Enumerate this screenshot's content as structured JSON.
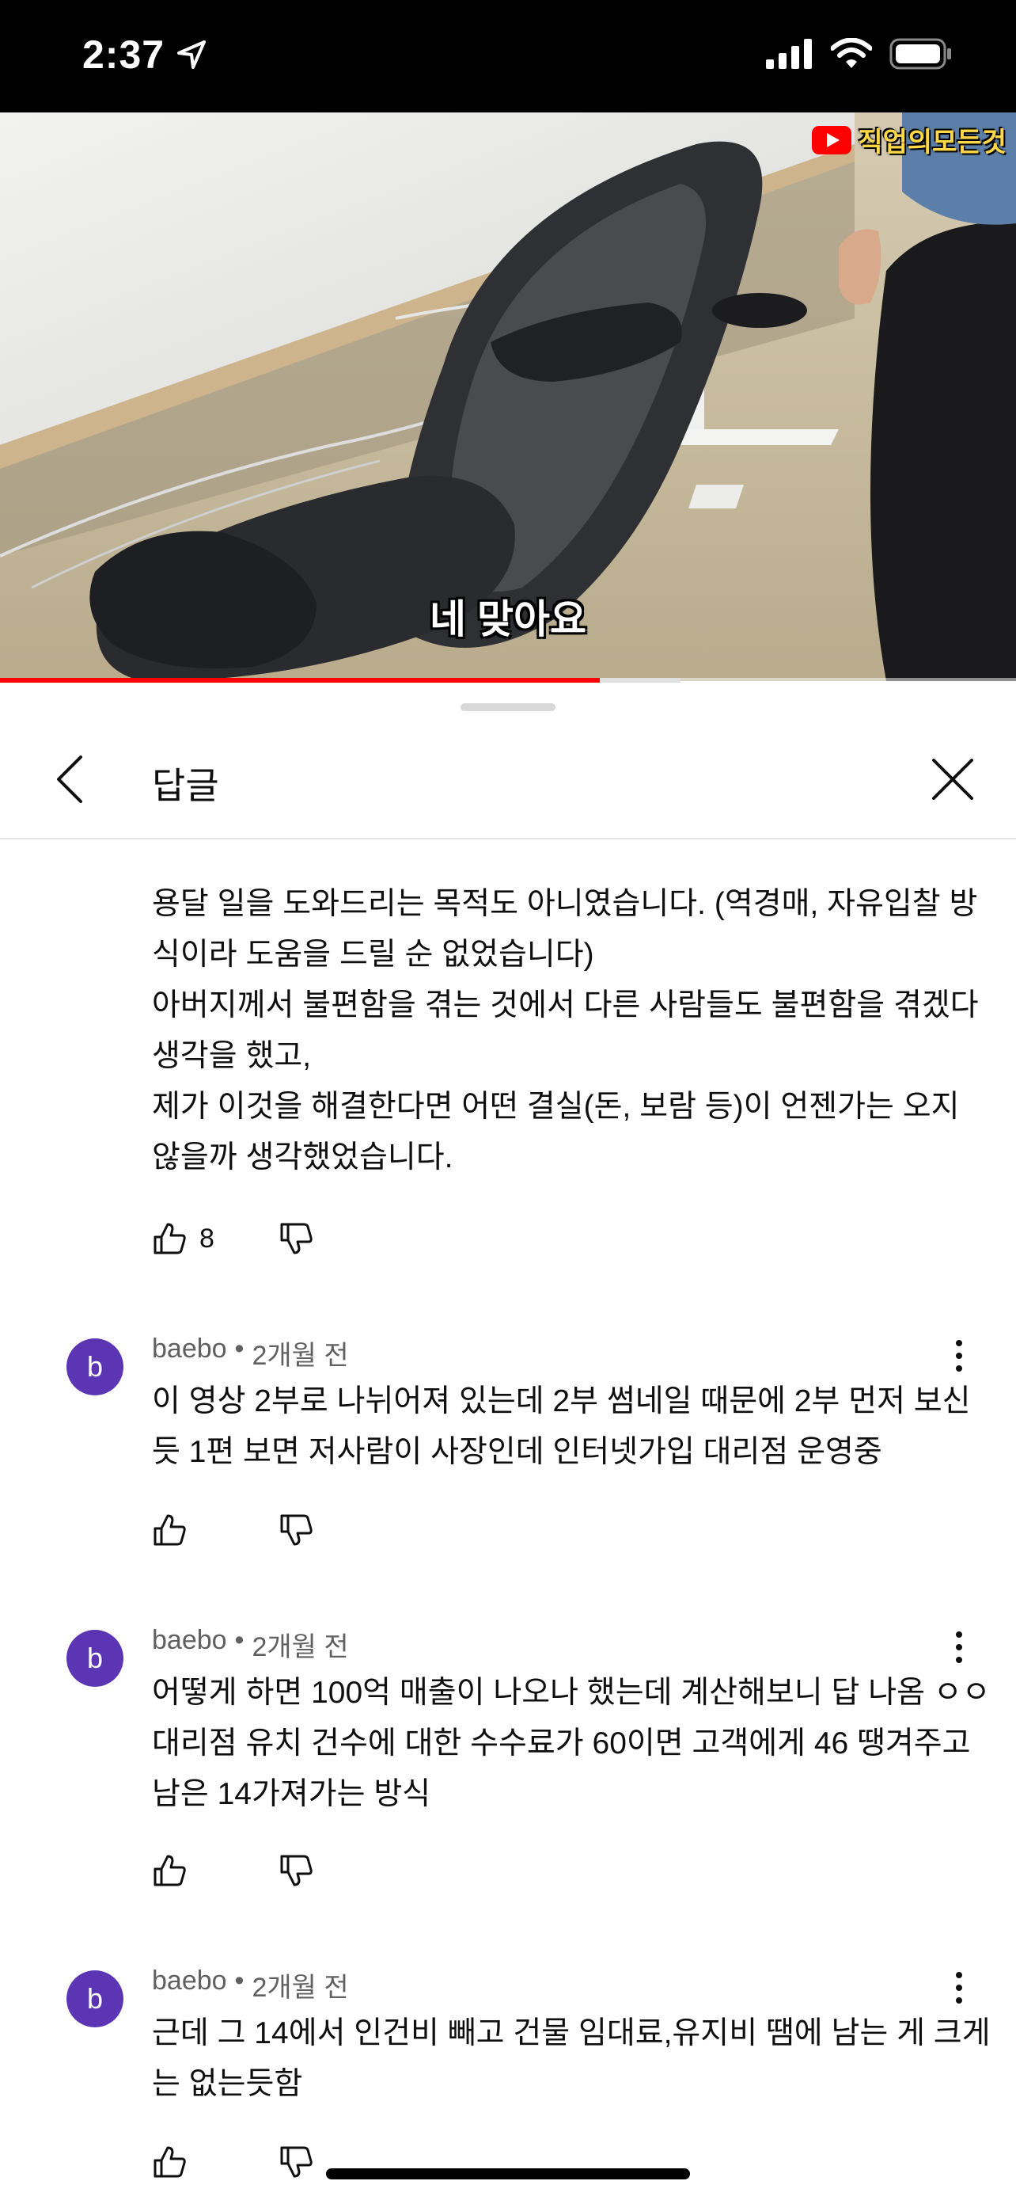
{
  "status_bar": {
    "time": "2:37"
  },
  "video": {
    "channel_watermark": "직업의모든것",
    "subtitle": "네 맞아요",
    "progress_fraction": 0.59,
    "buffered_fraction": 0.67
  },
  "panel": {
    "title": "답글"
  },
  "comments": [
    {
      "text": "용달 일을 도와드리는 목적도 아니였습니다. (역경매, 자유입찰 방식이라 도움을 드릴 순 없었습니다)\n아버지께서 불편함을 겪는 것에서 다른 사람들도 불편함을 겪겠다 생각을 했고,\n제가 이것을 해결한다면 어떤 결실(돈, 보람 등)이 언젠가는 오지 않을까 생각했었습니다.",
      "likes": "8"
    },
    {
      "avatar_letter": "b",
      "author": "baebo",
      "time": "2개월 전",
      "text": "이 영상 2부로 나뉘어져 있는데 2부 썸네일 때문에 2부 먼저 보신듯 1편 보면 저사람이 사장인데 인터넷가입 대리점 운영중"
    },
    {
      "avatar_letter": "b",
      "author": "baebo",
      "time": "2개월 전",
      "text": "어떻게 하면 100억 매출이 나오나 했는데 계산해보니 답 나옴 ㅇㅇ 대리점 유치 건수에 대한 수수료가 60이면 고객에게 46 땡겨주고 남은 14가져가는 방식"
    },
    {
      "avatar_letter": "b",
      "author": "baebo",
      "time": "2개월 전",
      "text": "근데 그 14에서 인건비 빼고 건물 임대료,유지비 땜에 남는 게 크게는 없는듯함"
    }
  ],
  "separator": "•",
  "colors": {
    "avatar": "#5c35b5",
    "progress": "#ff0000",
    "watermark_text": "#ffd84a"
  },
  "icons": [
    "location-arrow-icon",
    "cellular-signal-icon",
    "wifi-icon",
    "battery-icon",
    "youtube-logo-icon",
    "back-chevron-icon",
    "close-icon",
    "thumbs-up-icon",
    "thumbs-down-icon",
    "more-vert-icon"
  ]
}
